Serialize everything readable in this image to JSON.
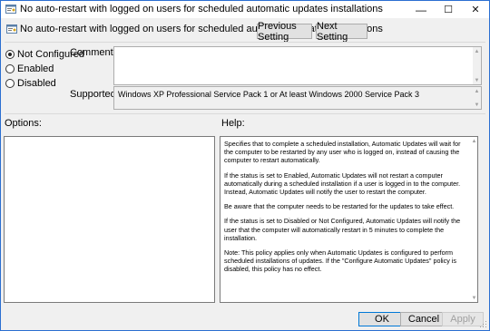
{
  "window": {
    "title": "No auto-restart with logged on users for scheduled automatic updates installations",
    "controls": {
      "minimize": "—",
      "maximize": "☐",
      "close": "✕"
    }
  },
  "header": {
    "policy_name": "No auto-restart with logged on users for scheduled automatic updates installations",
    "previous_label": "Previous Setting",
    "next_label": "Next Setting"
  },
  "state": {
    "options": [
      {
        "label": "Not Configured",
        "checked": true
      },
      {
        "label": "Enabled",
        "checked": false
      },
      {
        "label": "Disabled",
        "checked": false
      }
    ]
  },
  "comment": {
    "label": "Comment:",
    "value": ""
  },
  "supported": {
    "label": "Supported on:",
    "value": "Windows XP Professional Service Pack 1 or At least Windows 2000 Service Pack 3"
  },
  "options_section": {
    "label": "Options:"
  },
  "help_section": {
    "label": "Help:",
    "paragraphs": [
      "Specifies that to complete a scheduled installation, Automatic Updates will wait for the computer to be restarted by any user who is logged on, instead of causing the computer to restart automatically.",
      "If the status is set to Enabled, Automatic Updates will not restart a computer automatically during a scheduled installation if a user is logged in to the computer. Instead, Automatic Updates will notify the user to restart the computer.",
      "Be aware that the computer needs to be restarted for the updates to take effect.",
      "If the status is set to Disabled or Not Configured, Automatic Updates will notify the user that the computer will automatically restart in 5 minutes to complete the installation.",
      "Note: This policy applies only when Automatic Updates is configured to perform scheduled installations of updates. If the \"Configure Automatic Updates\" policy is disabled, this policy has no effect."
    ]
  },
  "footer": {
    "ok_label": "OK",
    "cancel_label": "Cancel",
    "apply_label": "Apply"
  },
  "colors": {
    "accent": "#0078d7",
    "window_border": "#2b6fd1",
    "background": "#f0f0f0"
  },
  "icons": {
    "title": "policy-settings-icon",
    "header": "policy-settings-icon"
  }
}
